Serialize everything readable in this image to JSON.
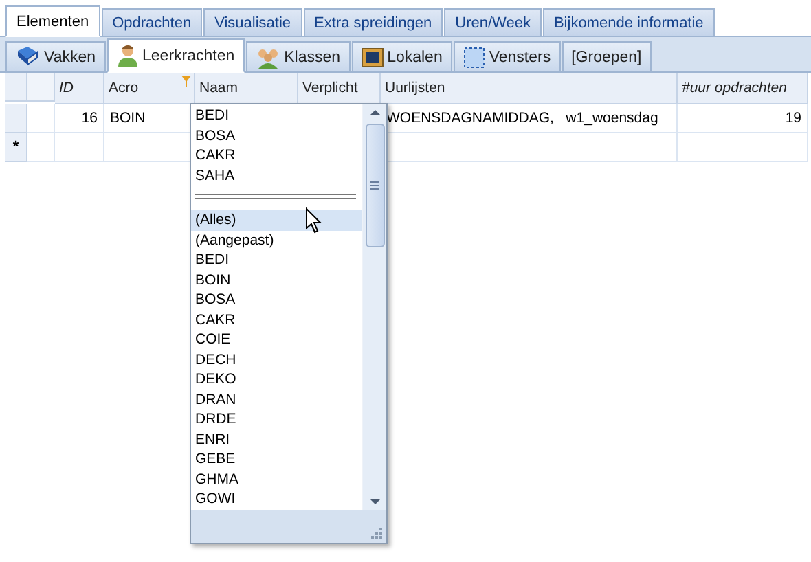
{
  "tabs": [
    {
      "label": "Elementen",
      "selected": true
    },
    {
      "label": "Opdrachten",
      "selected": false
    },
    {
      "label": "Visualisatie",
      "selected": false
    },
    {
      "label": "Extra spreidingen",
      "selected": false
    },
    {
      "label": "Uren/Week",
      "selected": false
    },
    {
      "label": "Bijkomende informatie",
      "selected": false
    }
  ],
  "subtabs": [
    {
      "label": "Vakken",
      "kind": "book",
      "selected": false
    },
    {
      "label": "Leerkrachten",
      "kind": "person",
      "selected": true
    },
    {
      "label": "Klassen",
      "kind": "group",
      "selected": false
    },
    {
      "label": "Lokalen",
      "kind": "screen",
      "selected": false
    },
    {
      "label": "Vensters",
      "kind": "frame",
      "selected": false
    },
    {
      "label": "[Groepen]",
      "kind": "none",
      "selected": false
    }
  ],
  "table": {
    "columns": [
      {
        "label": "ID",
        "italic": true,
        "filtered": false
      },
      {
        "label": "Acro",
        "italic": false,
        "filtered": true
      },
      {
        "label": "Naam",
        "italic": false,
        "filtered": false
      },
      {
        "label": "Verplicht",
        "italic": false,
        "filtered": false
      },
      {
        "label": "Uurlijsten",
        "italic": false,
        "filtered": false
      },
      {
        "label": "#uur opdrachten",
        "italic": true,
        "filtered": false
      }
    ],
    "rows": [
      {
        "cells": [
          "16",
          "BOIN",
          "",
          "",
          "WOENSDAGNAMIDDAG,   w1_woensdag",
          "19"
        ]
      }
    ],
    "new_row_marker": "*"
  },
  "filter_dropdown": {
    "chosen": [
      "BEDI",
      "BOSA",
      "CAKR",
      "SAHA"
    ],
    "options": [
      {
        "label": "(Alles)",
        "highlighted": true
      },
      {
        "label": "(Aangepast)",
        "highlighted": false
      },
      {
        "label": "BEDI",
        "highlighted": false
      },
      {
        "label": "BOIN",
        "highlighted": false
      },
      {
        "label": "BOSA",
        "highlighted": false
      },
      {
        "label": "CAKR",
        "highlighted": false
      },
      {
        "label": "COIE",
        "highlighted": false
      },
      {
        "label": "DECH",
        "highlighted": false
      },
      {
        "label": "DEKO",
        "highlighted": false
      },
      {
        "label": "DRAN",
        "highlighted": false
      },
      {
        "label": "DRDE",
        "highlighted": false
      },
      {
        "label": "ENRI",
        "highlighted": false
      },
      {
        "label": "GEBE",
        "highlighted": false
      },
      {
        "label": "GHMA",
        "highlighted": false
      },
      {
        "label": "GOWI",
        "highlighted": false
      }
    ]
  }
}
